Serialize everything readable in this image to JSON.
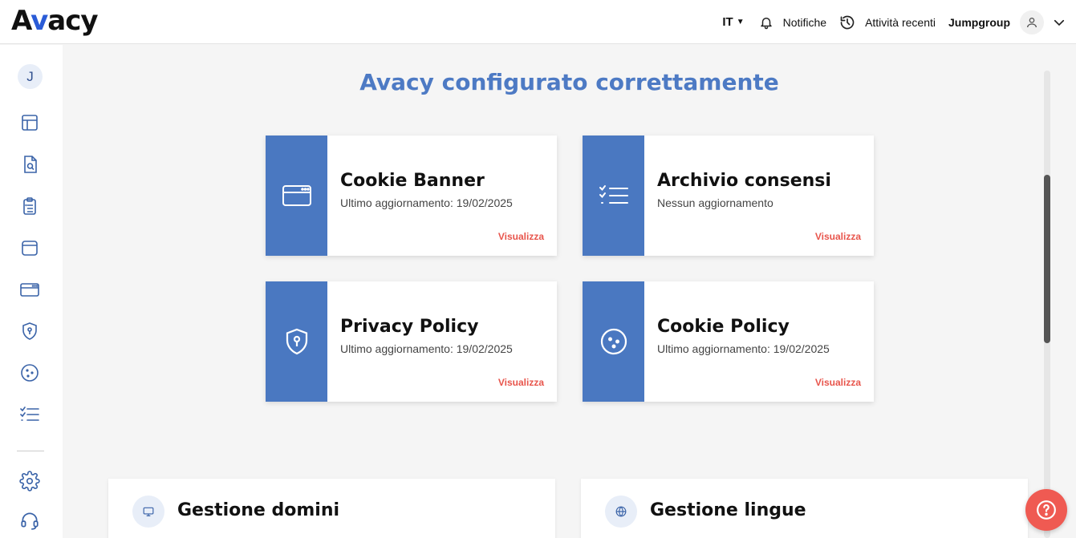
{
  "header": {
    "logo_text": "Avacy",
    "language": "IT",
    "notifications_label": "Notifiche",
    "recent_activity_label": "Attività recenti",
    "user_name": "Jumpgroup"
  },
  "sidebar": {
    "avatar_initial": "J",
    "items": [
      {
        "icon": "layout-icon"
      },
      {
        "icon": "document-search-icon"
      },
      {
        "icon": "clipboard-list-icon"
      },
      {
        "icon": "archive-box-icon"
      },
      {
        "icon": "browser-window-icon"
      },
      {
        "icon": "shield-keyhole-icon"
      },
      {
        "icon": "cookie-icon"
      },
      {
        "icon": "checklist-icon"
      },
      {
        "icon": "gear-icon"
      },
      {
        "icon": "headset-icon"
      }
    ]
  },
  "main": {
    "title": "Avacy configurato correttamente",
    "cards": [
      {
        "title": "Cookie Banner",
        "subtitle": "Ultimo aggiornamento: 19/02/2025",
        "link": "Visualizza",
        "icon": "browser-window-icon"
      },
      {
        "title": "Archivio consensi",
        "subtitle": "Nessun aggiornamento",
        "link": "Visualizza",
        "icon": "checklist-icon"
      },
      {
        "title": "Privacy Policy",
        "subtitle": "Ultimo aggiornamento: 19/02/2025",
        "link": "Visualizza",
        "icon": "shield-keyhole-icon"
      },
      {
        "title": "Cookie Policy",
        "subtitle": "Ultimo aggiornamento: 19/02/2025",
        "link": "Visualizza",
        "icon": "cookie-icon"
      }
    ],
    "panels": [
      {
        "title": "Gestione domini",
        "icon": "monitor-icon"
      },
      {
        "title": "Gestione lingue",
        "icon": "globe-icon"
      }
    ]
  },
  "colors": {
    "accent": "#4a78c1",
    "title": "#4d7ac4",
    "link": "#e8554c",
    "help": "#ef5a52"
  }
}
